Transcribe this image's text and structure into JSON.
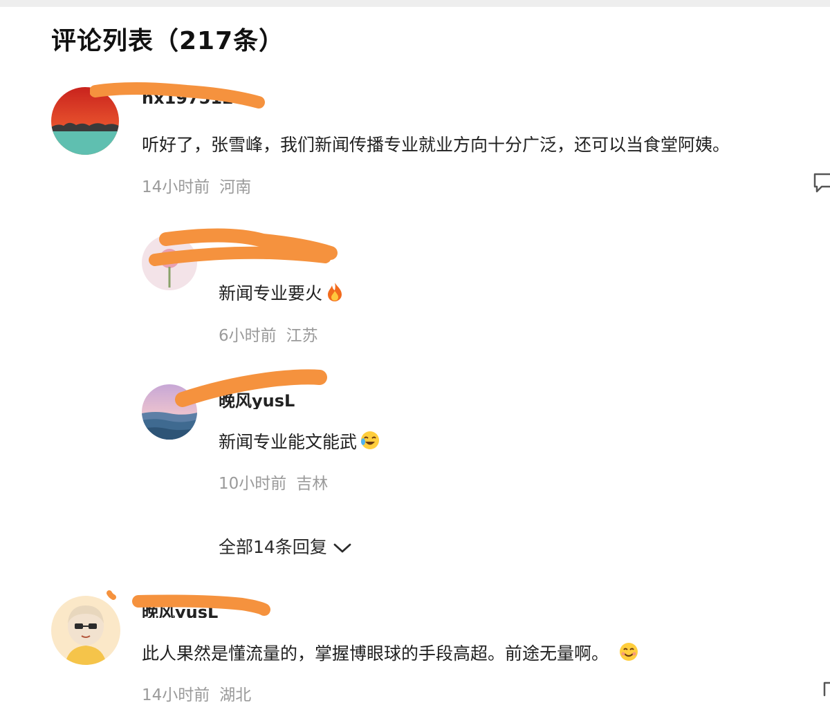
{
  "header": {
    "title": "评论列表（217条）"
  },
  "comments": [
    {
      "username": "nx197512",
      "text": "听好了，张雪峰，我们新闻传播专业就业方向十分广泛，还可以当食堂阿姨。",
      "time": "14小时前",
      "location": "河南",
      "avatar": "sunset-sea-avatar"
    },
    {
      "username": "晚风yusL",
      "text": "此人果然是懂流量的，掌握博眼球的手段高超。前途无量啊。",
      "time": "14小时前",
      "location": "湖北",
      "avatar": "cartoon-girl-avatar",
      "emoji": "smile-emoji"
    }
  ],
  "replies": [
    {
      "username": "",
      "text": "新闻专业要火",
      "time": "6小时前",
      "location": "江苏",
      "avatar": "flower-avatar",
      "emoji": "fire-emoji"
    },
    {
      "username": "晚风yusL",
      "text": "新闻专业能文能武",
      "time": "10小时前",
      "location": "吉林",
      "avatar": "ocean-avatar",
      "emoji": "laughing-tears-emoji"
    }
  ],
  "more_replies": {
    "label": "全部14条回复"
  },
  "colors": {
    "redaction": "#f5923e",
    "meta": "#9a9a9a"
  }
}
